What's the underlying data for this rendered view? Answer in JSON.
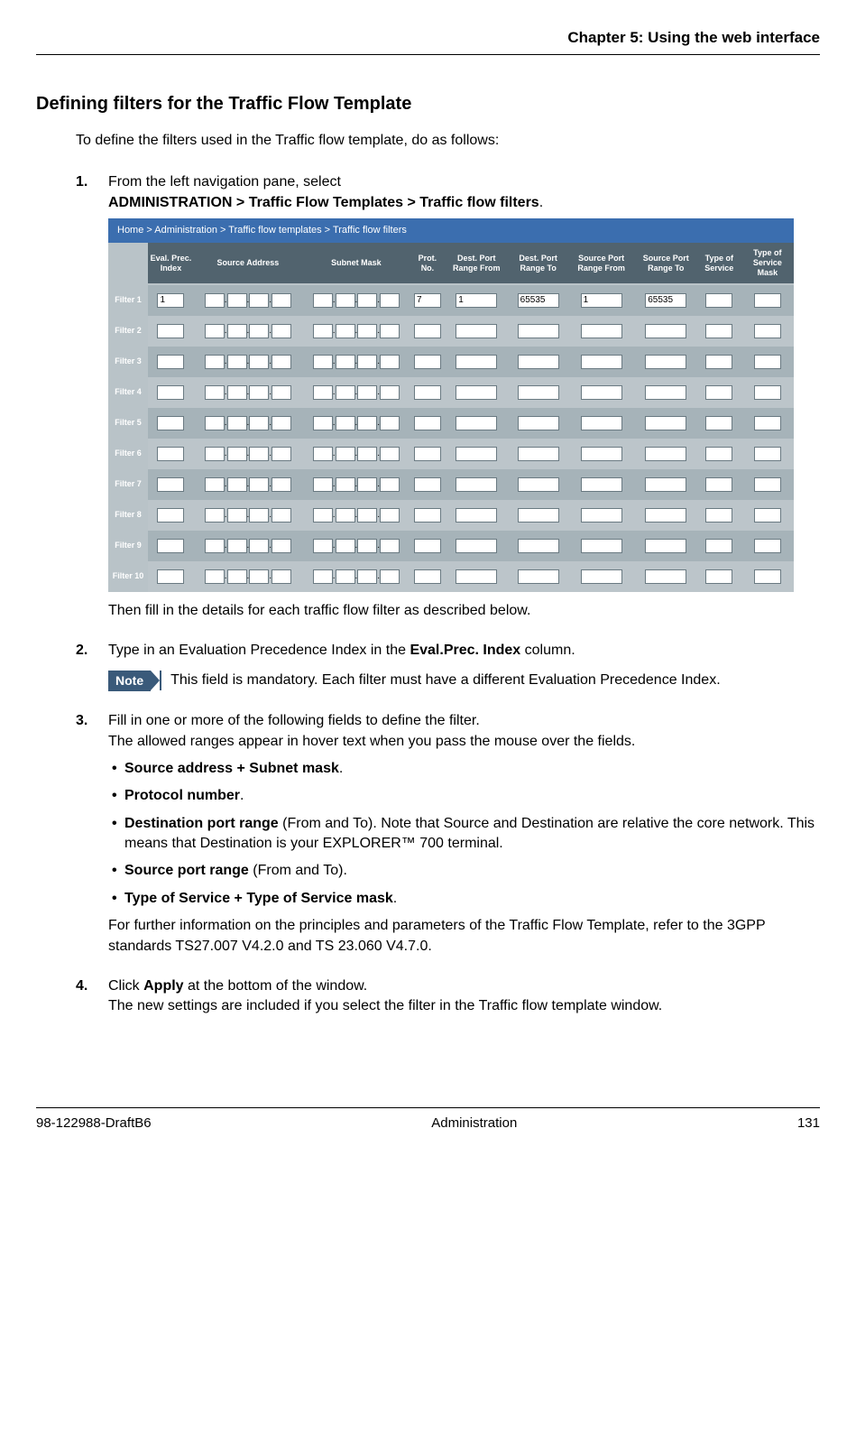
{
  "chapter": "Chapter 5: Using the web interface",
  "section_heading": "Defining filters for the Traffic Flow Template",
  "intro": "To define the filters used in the Traffic flow template, do as follows:",
  "step1": {
    "lead": "From the left navigation pane, select",
    "path": "ADMINISTRATION > Traffic Flow Templates > Traffic flow filters",
    "after_fig": "Then fill in the details for each traffic flow filter as described below."
  },
  "app": {
    "breadcrumb": "Home > Administration > Traffic flow templates > Traffic flow filters",
    "headers": [
      "Eval. Prec. Index",
      "Source Address",
      "Subnet Mask",
      "Prot. No.",
      "Dest. Port Range From",
      "Dest. Port Range To",
      "Source Port Range From",
      "Source Port Range To",
      "Type of Service",
      "Type of Service Mask"
    ],
    "rows": [
      {
        "label": "Filter 1",
        "epi": "1",
        "prot": "7",
        "dpf": "1",
        "dpt": "65535",
        "spf": "1",
        "spt": "65535"
      },
      {
        "label": "Filter 2",
        "epi": "",
        "prot": "",
        "dpf": "",
        "dpt": "",
        "spf": "",
        "spt": ""
      },
      {
        "label": "Filter 3",
        "epi": "",
        "prot": "",
        "dpf": "",
        "dpt": "",
        "spf": "",
        "spt": ""
      },
      {
        "label": "Filter 4",
        "epi": "",
        "prot": "",
        "dpf": "",
        "dpt": "",
        "spf": "",
        "spt": ""
      },
      {
        "label": "Filter 5",
        "epi": "",
        "prot": "",
        "dpf": "",
        "dpt": "",
        "spf": "",
        "spt": ""
      },
      {
        "label": "Filter 6",
        "epi": "",
        "prot": "",
        "dpf": "",
        "dpt": "",
        "spf": "",
        "spt": ""
      },
      {
        "label": "Filter 7",
        "epi": "",
        "prot": "",
        "dpf": "",
        "dpt": "",
        "spf": "",
        "spt": ""
      },
      {
        "label": "Filter 8",
        "epi": "",
        "prot": "",
        "dpf": "",
        "dpt": "",
        "spf": "",
        "spt": ""
      },
      {
        "label": "Filter 9",
        "epi": "",
        "prot": "",
        "dpf": "",
        "dpt": "",
        "spf": "",
        "spt": ""
      },
      {
        "label": "Filter 10",
        "epi": "",
        "prot": "",
        "dpf": "",
        "dpt": "",
        "spf": "",
        "spt": ""
      }
    ]
  },
  "step2": {
    "text_a": "Type in an Evaluation Precedence Index in the ",
    "bold": "Eval.Prec. Index",
    "text_b": " column.",
    "note_label": "Note",
    "note": "This field is mandatory. Each filter must have a different Evaluation Precedence Index."
  },
  "step3": {
    "line1": "Fill in one or more of the following fields to define the filter.",
    "line2": "The allowed ranges appear in hover text when you pass the mouse over the fields.",
    "b1": "Source address + Subnet mask",
    "b2": "Protocol number",
    "b3a": "Destination port range",
    "b3b": " (From and To). Note that Source and Destination are relative the core network. This means that Destination is your EXPLORER™ 700 terminal.",
    "b4a": "Source port range",
    "b4b": " (From and To).",
    "b5": "Type of Service + Type of Service mask",
    "tail": "For further information on the principles and parameters of the Traffic Flow Template, refer to the 3GPP standards TS27.007 V4.2.0 and TS 23.060 V4.7.0."
  },
  "step4": {
    "a": "Click ",
    "bold": "Apply",
    "b": " at the bottom of the window.",
    "line2": "The new settings are included if you select the filter in the Traffic flow template window."
  },
  "footer": {
    "left": "98-122988-DraftB6",
    "center": "Administration",
    "right": "131"
  }
}
